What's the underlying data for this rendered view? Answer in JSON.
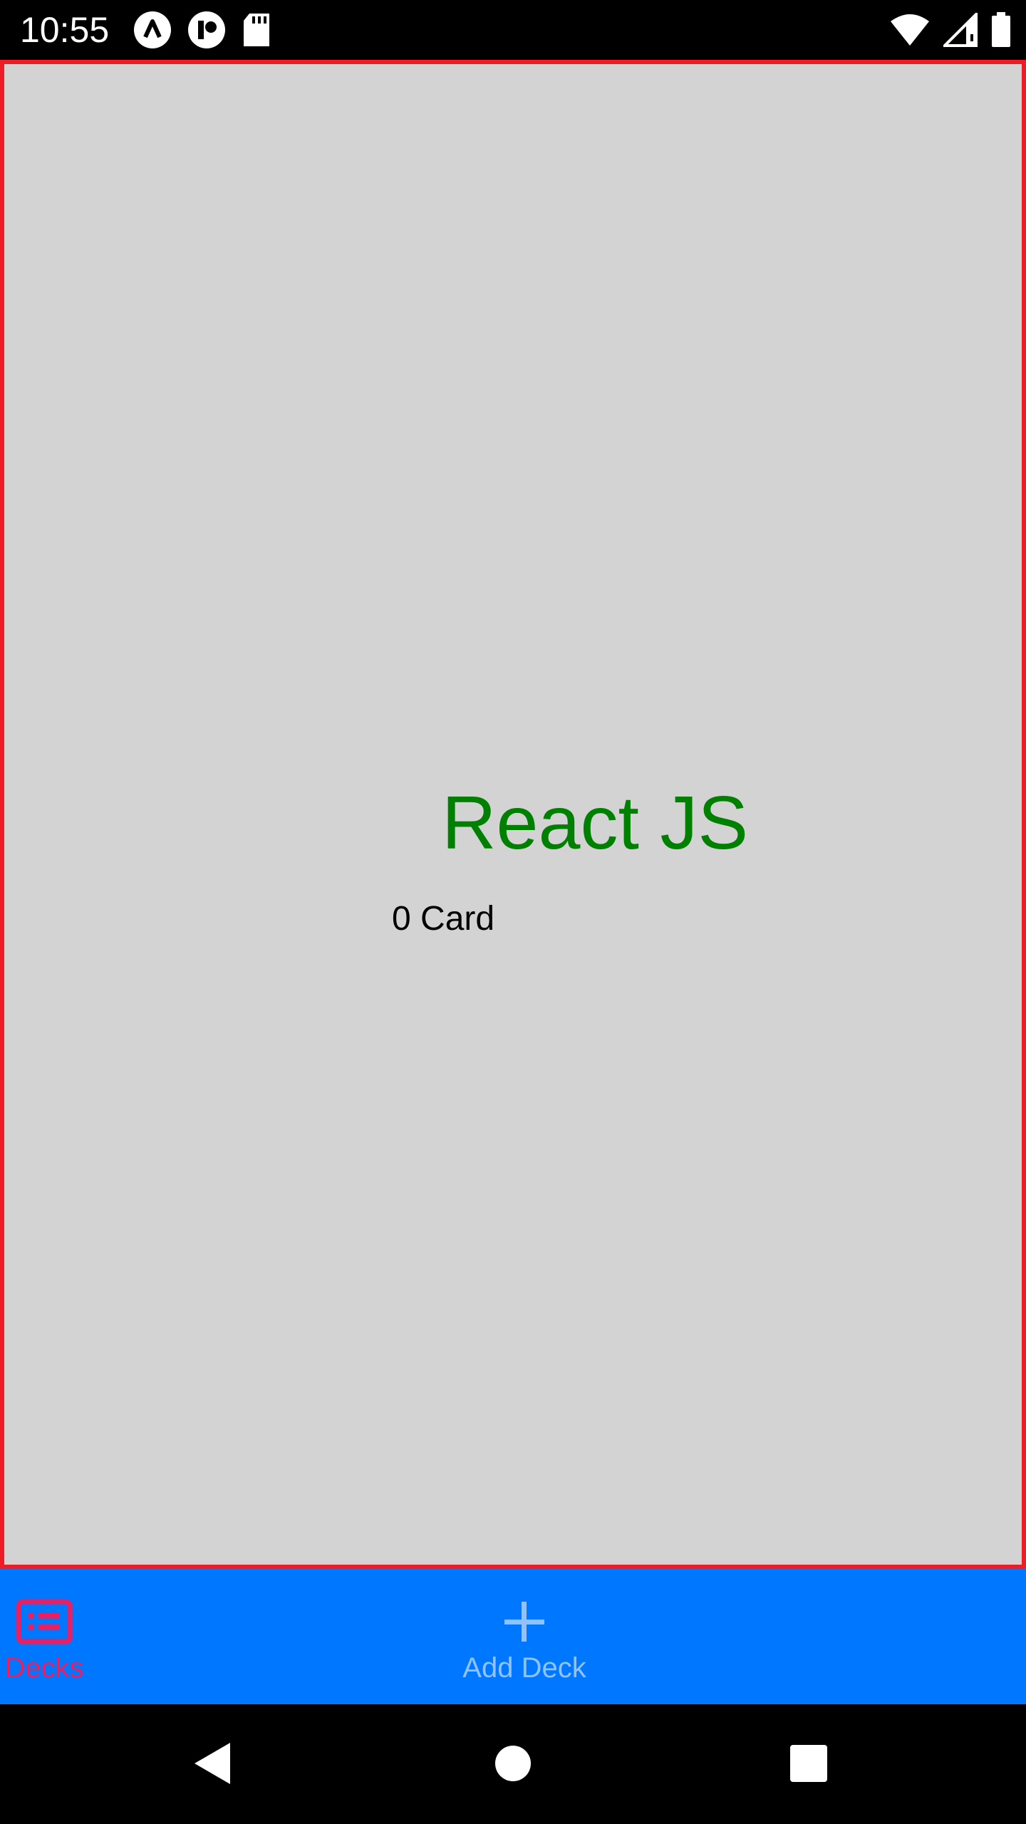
{
  "status_bar": {
    "time": "10:55",
    "left_icons": [
      "app-notification-icon",
      "app-notification-icon-2",
      "sd-card-icon"
    ],
    "right_icons": [
      "wifi-icon",
      "cell-signal-icon",
      "battery-icon"
    ]
  },
  "deck": {
    "title": "React JS",
    "card_count": "0 Card"
  },
  "tabs": [
    {
      "label": "Decks",
      "icon": "deck-list-icon",
      "active": true,
      "color": "#e91e63"
    },
    {
      "label": "Add Deck",
      "icon": "plus-icon",
      "active": false,
      "color": "#8fc2ff"
    }
  ],
  "nav_bar": {
    "buttons": [
      "back-icon",
      "home-icon",
      "recents-icon"
    ]
  },
  "colors": {
    "content_bg": "#d3d3d3",
    "content_border": "#ee1c24",
    "title": "#008000",
    "tab_bar_bg": "#0077ff"
  }
}
